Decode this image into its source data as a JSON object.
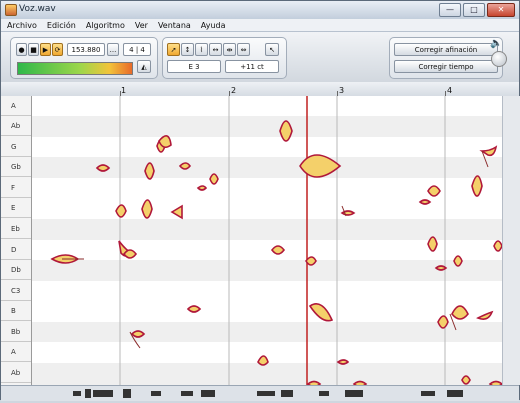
{
  "window": {
    "title": "Voz.wav",
    "minimize": "—",
    "maximize": "□",
    "close": "✕"
  },
  "menu": [
    "Archivo",
    "Edición",
    "Algoritmo",
    "Ver",
    "Ventana",
    "Ayuda"
  ],
  "transport": {
    "tempo": "153.880",
    "more": "...",
    "time_sig": "4 | 4"
  },
  "info": {
    "note": "E 3",
    "cents": "+11 ct"
  },
  "buttons": {
    "correct_pitch": "Corregir afinación",
    "correct_time": "Corregir tiempo"
  },
  "ruler": [
    "2",
    "3",
    "4"
  ],
  "ruler_marker": "1",
  "pitch_labels": [
    "A",
    "Ab",
    "G",
    "Gb",
    "F",
    "E",
    "Eb",
    "D",
    "Db",
    "C3",
    "B",
    "Bb",
    "A",
    "Ab"
  ],
  "icons": {
    "record": "record-icon",
    "stop": "stop-icon",
    "play": "play-icon",
    "loop": "loop-icon",
    "metronome": "metronome-icon",
    "volume": "speaker-icon",
    "tools": [
      "arrow-tool-icon",
      "pitch-tool-icon",
      "formant-tool-icon",
      "note-assign-tool-icon",
      "timing-tool-icon",
      "split-tool-icon"
    ]
  },
  "colors": {
    "blob_fill": "#f4d06a",
    "blob_edge": "#b0183a",
    "playhead": "#c02020",
    "meter_green": "#2fb84a",
    "meter_orange": "#e86a2a"
  },
  "playhead_position_beats": 2.7
}
